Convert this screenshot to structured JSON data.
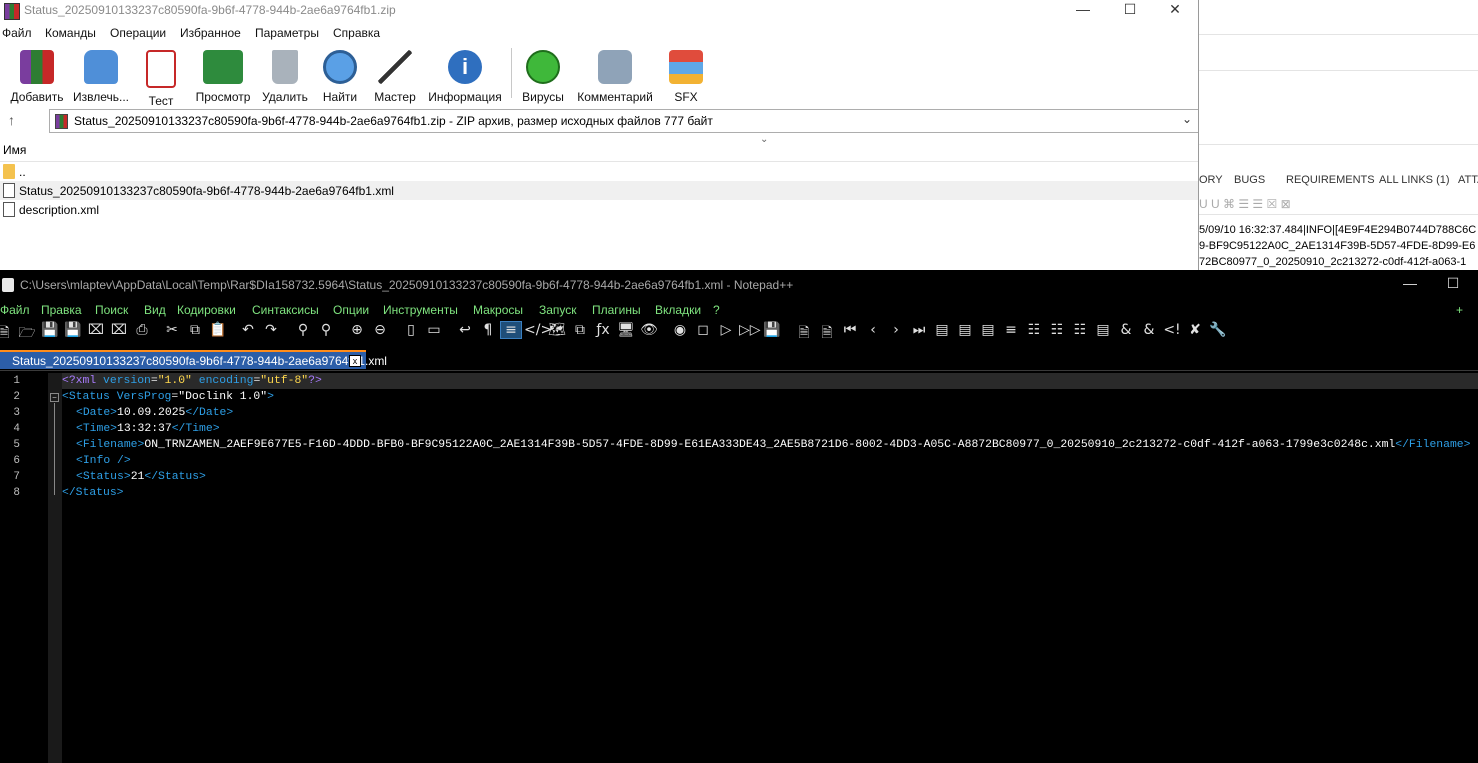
{
  "background_window": {
    "tabs": [
      "ORY",
      "BUGS",
      "REQUIREMENTS",
      "ALL LINKS (1)",
      "ATTA"
    ],
    "toolbar": "U  U  ⌘  ☰  ☰  ☒  ⊠",
    "logs": [
      "5/09/10 16:32:37.484|INFO|[4E9F4E294B0744D788C6C",
      "9-BF9C95122A0C_2AE1314F39B-5D57-4FDE-8D99-E6",
      "72BC80977_0_20250910_2c213272-c0df-412f-a063-1"
    ]
  },
  "winrar": {
    "title": "Status_20250910133237c80590fa-9b6f-4778-944b-2ae6a9764fb1.zip",
    "menu": [
      "Файл",
      "Команды",
      "Операции",
      "Избранное",
      "Параметры",
      "Справка"
    ],
    "toolbar": [
      {
        "label": "Добавить",
        "icon": "add-archive-icon"
      },
      {
        "label": "Извлечь...",
        "icon": "extract-icon"
      },
      {
        "label": "Тест",
        "icon": "test-icon"
      },
      {
        "label": "Просмотр",
        "icon": "view-icon"
      },
      {
        "label": "Удалить",
        "icon": "delete-icon"
      },
      {
        "label": "Найти",
        "icon": "find-icon"
      },
      {
        "label": "Мастер",
        "icon": "wizard-icon"
      },
      {
        "label": "Информация",
        "icon": "info-icon"
      },
      {
        "label": "Вирусы",
        "icon": "virus-scan-icon"
      },
      {
        "label": "Комментарий",
        "icon": "comment-icon"
      },
      {
        "label": "SFX",
        "icon": "sfx-icon"
      }
    ],
    "path": "Status_20250910133237c80590fa-9b6f-4778-944b-2ae6a9764fb1.zip - ZIP архив, размер исходных файлов 777 байт",
    "column_name": "Имя",
    "files": [
      {
        "name": "..",
        "icon": "folder-icon"
      },
      {
        "name": "Status_20250910133237c80590fa-9b6f-4778-944b-2ae6a9764fb1.xml",
        "icon": "xml-file-icon"
      },
      {
        "name": "description.xml",
        "icon": "xml-file-icon"
      }
    ]
  },
  "notepad": {
    "title": "C:\\Users\\mlaptev\\AppData\\Local\\Temp\\Rar$DIa158732.5964\\Status_20250910133237c80590fa-9b6f-4778-944b-2ae6a9764fb1.xml - Notepad++",
    "menu": [
      "Файл",
      "Правка",
      "Поиск",
      "Вид",
      "Кодировки",
      "Синтаксисы",
      "Опции",
      "Инструменты",
      "Макросы",
      "Запуск",
      "Плагины",
      "Вкладки",
      "?"
    ],
    "menu_plus": "+",
    "tab": "Status_20250910133237c80590fa-9b6f-4778-944b-2ae6a9764fb1.xml",
    "tab_close": "x",
    "line_numbers": [
      "1",
      "2",
      "3",
      "4",
      "5",
      "6",
      "7",
      "8"
    ],
    "code": {
      "l1": {
        "pi_open": "<?xml",
        "a1": " version",
        "eq1": "=",
        "v1": "\"1.0\"",
        "a2": " encoding",
        "eq2": "=",
        "v2": "\"utf-8\"",
        "pi_close": "?>"
      },
      "l2": {
        "open": "<Status",
        "a1": " VersProg",
        "eq": "=",
        "v1": "\"Doclink 1.0\"",
        "close": ">"
      },
      "l3": {
        "open": "<Date>",
        "text": "10.09.2025",
        "close": "</Date>"
      },
      "l4": {
        "open": "<Time>",
        "text": "13:32:37",
        "close": "</Time>"
      },
      "l5": {
        "open": "<Filename>",
        "text": "ON_TRNZAMEN_2AEF9E677E5-F16D-4DDD-BFB0-BF9C95122A0C_2AE1314F39B-5D57-4FDE-8D99-E61EA333DE43_2AE5B8721D6-8002-4DD3-A05C-A8872BC80977_0_20250910_2c213272-c0df-412f-a063-1799e3c0248c.xml",
        "close": "</Filename>"
      },
      "l6": {
        "tag": "<Info />"
      },
      "l7": {
        "open": "<Status>",
        "text": "21",
        "close": "</Status>"
      },
      "l8": {
        "close": "</Status>"
      }
    }
  }
}
